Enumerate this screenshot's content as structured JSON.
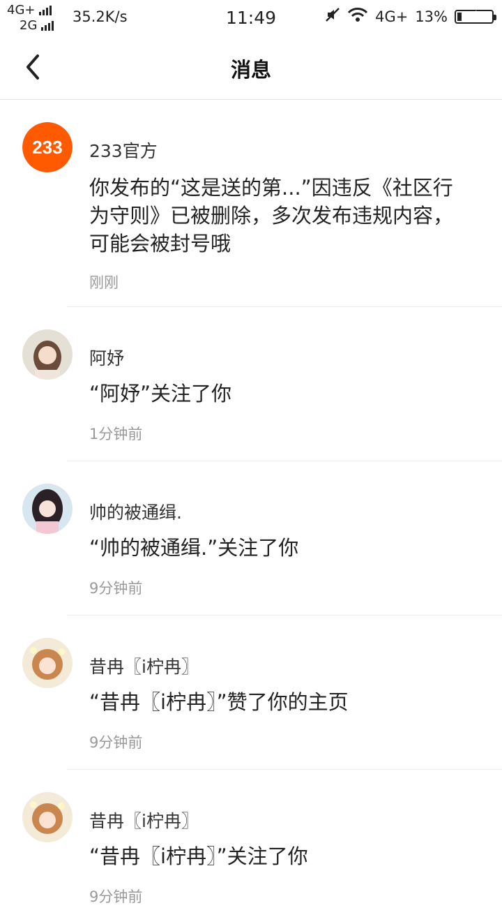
{
  "status_bar": {
    "net1": "4G+",
    "net2": "2G",
    "speed": "35.2K/s",
    "time": "11:49",
    "net_right": "4G+",
    "battery": "13%",
    "battery_level": 0.13
  },
  "header": {
    "title": "消息"
  },
  "messages": [
    {
      "name": "233官方",
      "avatar": "avatar-233-logo",
      "avatar_text": "233",
      "content": "你发布的“这是送的第...”因违反《社区行为守则》已被删除，多次发布违规内容，可能会被封号哦",
      "time": "刚刚"
    },
    {
      "name": "阿妤",
      "avatar": "avatar-portrait",
      "content": "“阿妤”关注了你",
      "time": "1分钟前"
    },
    {
      "name": "帅的被通缉.",
      "avatar": "avatar-portrait",
      "content": "“帅的被通缉.”关注了你",
      "time": "9分钟前"
    },
    {
      "name": "昔冉〖i柠冉〗",
      "avatar": "avatar-portrait",
      "content": "“昔冉〖i柠冉〗”赞了你的主页",
      "time": "9分钟前"
    },
    {
      "name": "昔冉〖i柠冉〗",
      "avatar": "avatar-portrait",
      "content": "“昔冉〖i柠冉〗”关注了你",
      "time": "9分钟前"
    }
  ],
  "colors": {
    "logo": "#ff5a00",
    "meta": "#999999"
  }
}
